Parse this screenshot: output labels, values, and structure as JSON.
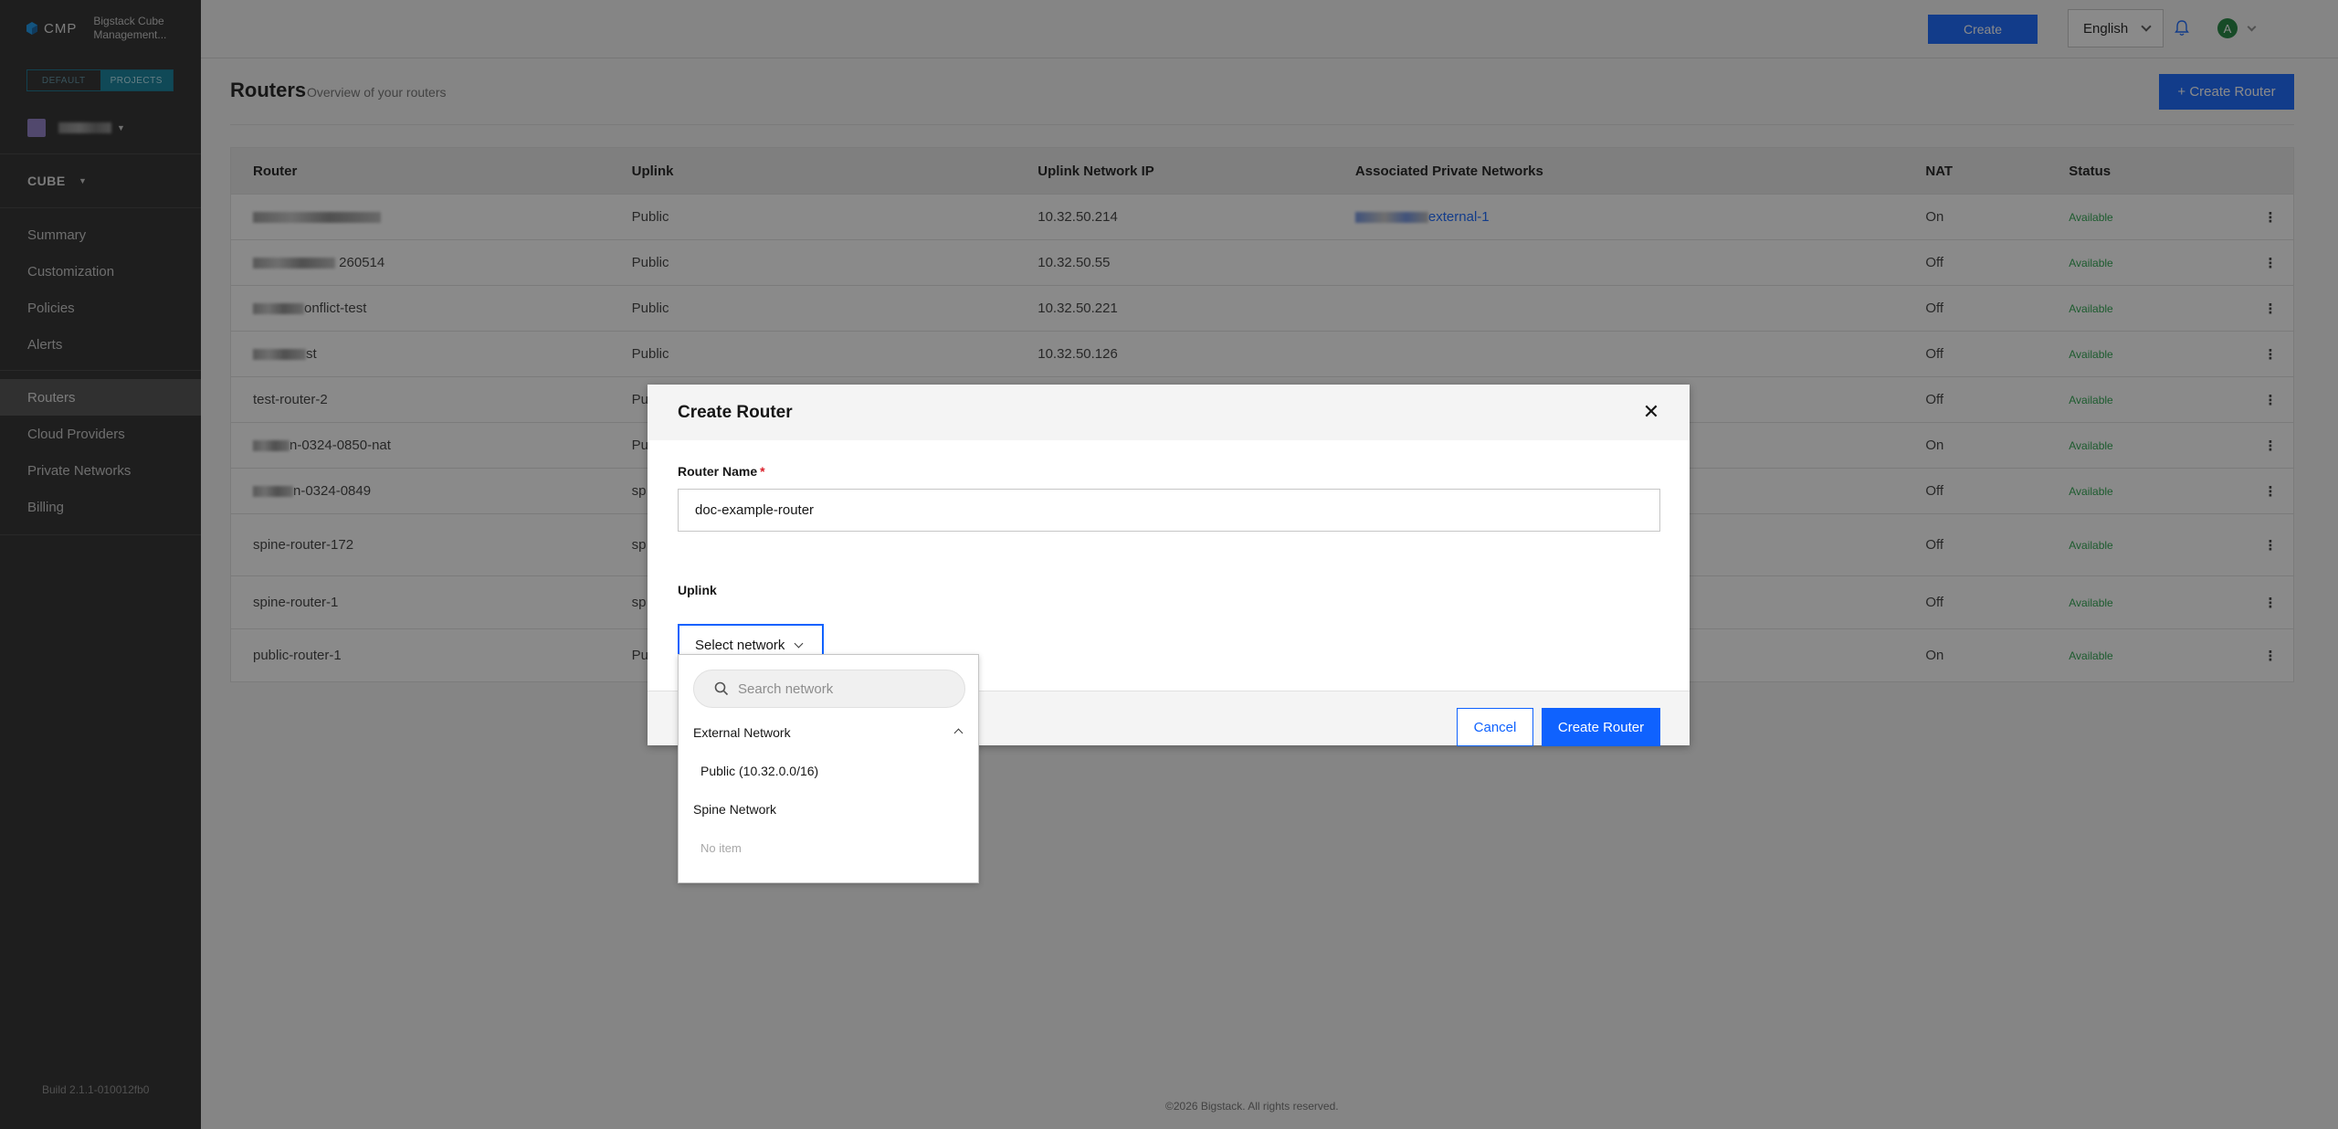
{
  "brand": {
    "name": "CMP",
    "subtitle": "Bigstack Cube Management..."
  },
  "scope": {
    "default_label": "DEFAULT",
    "projects_label": "PROJECTS"
  },
  "sidebar": {
    "section_label": "CUBE",
    "group1": [
      {
        "label": "Summary"
      },
      {
        "label": "Customization"
      },
      {
        "label": "Policies"
      },
      {
        "label": "Alerts"
      }
    ],
    "group2": [
      {
        "label": "Routers",
        "active": true
      },
      {
        "label": "Cloud Providers"
      },
      {
        "label": "Private Networks"
      },
      {
        "label": "Billing"
      }
    ],
    "build": "Build 2.1.1-010012fb0"
  },
  "header": {
    "create_label": "Create",
    "language": "English",
    "avatar_initial": "A"
  },
  "page": {
    "title": "Routers",
    "subtitle": "Overview of your routers",
    "create_router_label": "+ Create Router"
  },
  "table": {
    "columns": [
      "Router",
      "Uplink",
      "Uplink Network IP",
      "Associated Private Networks",
      "NAT",
      "Status"
    ],
    "rows": [
      {
        "router": "",
        "uplink": "Public",
        "ip": "10.32.50.214",
        "assoc": "external-1",
        "nat": "On",
        "status": "Available"
      },
      {
        "router": "260514",
        "uplink": "Public",
        "ip": "10.32.50.55",
        "assoc": "",
        "nat": "Off",
        "status": "Available"
      },
      {
        "router": "onflict-test",
        "uplink": "Public",
        "ip": "10.32.50.221",
        "assoc": "",
        "nat": "Off",
        "status": "Available"
      },
      {
        "router": "st",
        "uplink": "Public",
        "ip": "10.32.50.126",
        "assoc": "",
        "nat": "Off",
        "status": "Available"
      },
      {
        "router": "test-router-2",
        "uplink": "Pu",
        "ip": "",
        "assoc": "",
        "nat": "Off",
        "status": "Available"
      },
      {
        "router": "n-0324-0850-nat",
        "uplink": "Pu",
        "ip": "",
        "assoc": "",
        "nat": "On",
        "status": "Available"
      },
      {
        "router": "n-0324-0849",
        "uplink": "sp",
        "ip": "",
        "assoc": "",
        "nat": "Off",
        "status": "Available"
      },
      {
        "router": "spine-router-172",
        "uplink": "sp",
        "ip": "",
        "assoc": "",
        "nat": "Off",
        "status": "Available"
      },
      {
        "router": "spine-router-1",
        "uplink": "sp",
        "ip": "",
        "assoc": "",
        "nat": "Off",
        "status": "Available"
      },
      {
        "router": "public-router-1",
        "uplink": "Pu",
        "ip": "",
        "assoc": "",
        "nat": "On",
        "status": "Available"
      }
    ]
  },
  "footer": "©2026 Bigstack. All rights reserved.",
  "modal": {
    "title": "Create Router",
    "name_label": "Router Name",
    "required_mark": "*",
    "name_value": "doc-example-router",
    "uplink_label": "Uplink",
    "select_label": "Select network",
    "cancel_label": "Cancel",
    "create_label": "Create Router"
  },
  "dropdown": {
    "search_placeholder": "Search network",
    "group_external": "External Network",
    "option_public": "Public (10.32.0.0/16)",
    "group_spine": "Spine Network",
    "empty_label": "No item"
  },
  "colors": {
    "primary": "#0f62fe",
    "sidebar_bg": "#262626",
    "status_available": "#24a148"
  }
}
